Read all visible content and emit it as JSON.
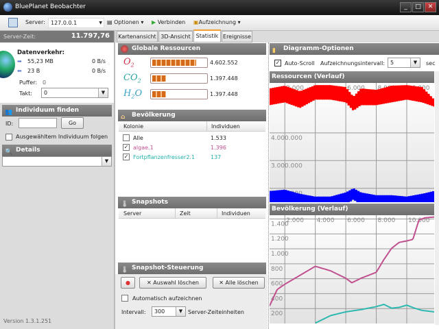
{
  "window": {
    "title": "BluePlanet Beobachter",
    "min": "_",
    "max": "□",
    "close": "✕"
  },
  "toolbar": {
    "server_label": "Server:",
    "server_value": "127.0.0.1",
    "optionen": "Optionen",
    "verbinden": "Verbinden",
    "aufzeichnung": "Aufzeichnung"
  },
  "left": {
    "server_zeit_label": "Server-Zeit:",
    "server_zeit_value": "11.797,76",
    "datenverkehr": "Datenverkehr:",
    "down_amount": "55,23 MB",
    "down_rate": "0 B/s",
    "up_amount": "23 B",
    "up_rate": "0 B/s",
    "puffer_label": "Puffer:",
    "puffer_value": "0",
    "takt_label": "Takt:",
    "takt_value": "0",
    "find_header": "Individuum finden",
    "id_label": "ID:",
    "id_value": "",
    "go": "Go",
    "follow_label": "Ausgewähltem Individuum folgen",
    "details_header": "Details",
    "details_value": "",
    "version": "Version 1.3.1.251"
  },
  "tabs": [
    "Kartenansicht",
    "3D-Ansicht",
    "Statistik",
    "Ereignisse"
  ],
  "ressourcen": {
    "header": "Globale Ressourcen",
    "items": [
      {
        "name": "O",
        "sub": "2",
        "value": "4.602.552",
        "fill": 0.82,
        "color": "#d0304a"
      },
      {
        "name": "CO",
        "sub": "2",
        "value": "1.397.448",
        "fill": 0.25,
        "color": "#2aa6a0"
      },
      {
        "name": "H",
        "sub": "2",
        "name2": "O",
        "value": "1.397.448",
        "fill": 0.25,
        "color": "#3aa0c8"
      }
    ]
  },
  "bevoelkerung": {
    "header": "Bevölkerung",
    "col_kolonie": "Kolonie",
    "col_individuen": "Individuen",
    "rows": [
      {
        "name": "Alle",
        "count": "1.533",
        "checked": false,
        "color": "#222"
      },
      {
        "name": "algae.1",
        "count": "1.396",
        "checked": true,
        "color": "#c05090"
      },
      {
        "name": "Fortpflanzenfresser2.1",
        "count": "137",
        "checked": true,
        "color": "#20b0a8"
      }
    ]
  },
  "snapshots": {
    "header": "Snapshots",
    "cols": [
      "Server",
      "Zeit",
      "Individuen"
    ]
  },
  "steuerung": {
    "header": "Snapshot-Steuerung",
    "auswahl": "Auswahl löschen",
    "alle": "Alle löschen",
    "auto_label": "Automatisch aufzeichnen",
    "intervall_label": "Intervall:",
    "intervall_value": "300",
    "einheit": "Server-Zeiteinheiten"
  },
  "optionen": {
    "header": "Diagramm-Optionen",
    "autoscroll": "Auto-Scroll",
    "intervall_label": "Aufzeichnungsintervall:",
    "intervall_value": "5",
    "unit": "sec"
  },
  "chart_data": [
    {
      "type": "line",
      "title": "Ressourcen (Verlauf)",
      "xlim": [
        1000,
        11800
      ],
      "ylim": [
        1500000,
        5800000
      ],
      "x_ticks": [
        "2.000",
        "4.000",
        "6.000",
        "8.000",
        "10.000"
      ],
      "x_tick_values": [
        2000,
        4000,
        6000,
        8000,
        10000
      ],
      "y_ticks": [
        "4.000.000",
        "3.000.000",
        "2.000.000"
      ],
      "y_tick_values": [
        4000000,
        3000000,
        2000000
      ],
      "x": [
        1000,
        2000,
        3000,
        4000,
        5000,
        6000,
        6500,
        7000,
        8000,
        9000,
        10000,
        11000,
        11800
      ],
      "series": [
        {
          "name": "O2",
          "color": "#ff0000",
          "low": [
            5000000,
            5100000,
            4900000,
            5200000,
            5200000,
            5100000,
            4800000,
            5000000,
            5000000,
            5100000,
            5200000,
            5100000,
            4950000
          ],
          "high": [
            5600000,
            5700000,
            5500000,
            5720000,
            5720000,
            5650000,
            5300000,
            5600000,
            5550000,
            5700000,
            5720000,
            5650000,
            5200000
          ]
        },
        {
          "name": "CO2/H2O",
          "color": "#0000ff",
          "low": [
            1400000,
            1450000,
            1350000,
            1300000,
            1300000,
            1400000,
            1600000,
            1400000,
            1300000,
            1300000,
            1350000,
            1400000,
            1500000
          ],
          "high": [
            1900000,
            1950000,
            1800000,
            1700000,
            1700000,
            1850000,
            2000000,
            1850000,
            1750000,
            1750000,
            1700000,
            1800000,
            1900000
          ]
        }
      ]
    },
    {
      "type": "line",
      "title": "Bevölkerung (Verlauf)",
      "xlim": [
        1000,
        11800
      ],
      "ylim": [
        0,
        1450
      ],
      "x_ticks": [
        "2.000",
        "4.000",
        "6.000",
        "8.000",
        "10.000"
      ],
      "x_tick_values": [
        2000,
        4000,
        6000,
        8000,
        10000
      ],
      "y_ticks": [
        "1.400",
        "1.200",
        "1.000",
        "800",
        "600",
        "400",
        "200"
      ],
      "y_tick_values": [
        1400,
        1200,
        1000,
        800,
        600,
        400,
        200
      ],
      "series": [
        {
          "name": "algae.1",
          "color": "#c0508f",
          "x": [
            1000,
            1500,
            2000,
            3000,
            4000,
            5000,
            6000,
            6400,
            7000,
            8000,
            8500,
            9000,
            9500,
            10000,
            10400,
            10800,
            11200,
            11800
          ],
          "y": [
            230,
            450,
            520,
            640,
            760,
            700,
            600,
            540,
            600,
            680,
            850,
            1000,
            1080,
            1100,
            1120,
            1380,
            1410,
            1420
          ]
        },
        {
          "name": "Fortpflanzenfresser2.1",
          "color": "#2cb8b0",
          "x": [
            4000,
            5000,
            6000,
            7000,
            8000,
            8500,
            9000,
            9500,
            10000,
            10500,
            11000,
            11800
          ],
          "y": [
            0,
            100,
            150,
            180,
            220,
            250,
            200,
            210,
            240,
            200,
            170,
            150
          ]
        }
      ]
    }
  ]
}
